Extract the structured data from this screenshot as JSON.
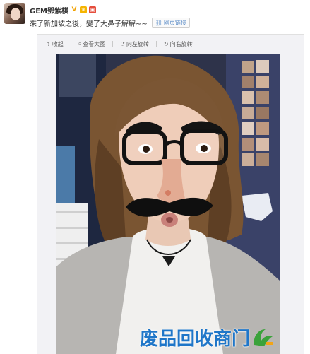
{
  "post": {
    "user_name": "GEM鄧紫棋",
    "verified_mark": "V",
    "text": "來了新加坡之後，變了大鼻子解解~~",
    "web_link_label": "网页链接"
  },
  "toolbar": {
    "collapse_label": "收起",
    "view_large_label": "查看大图",
    "rotate_left_label": "向左旋转",
    "rotate_right_label": "向右旋转"
  },
  "watermark": {
    "text": "废品回收商门"
  },
  "colors": {
    "link_blue": "#5b8cc7",
    "watermark_blue": "#1f76c8",
    "panel_bg": "#f2f2f5",
    "badge_gold": "#f5b400"
  },
  "icons": {
    "collapse": "arrow-up-icon",
    "view_large": "magnifier-icon",
    "rotate_left": "rotate-left-icon",
    "rotate_right": "rotate-right-icon",
    "web_link": "link-icon"
  }
}
